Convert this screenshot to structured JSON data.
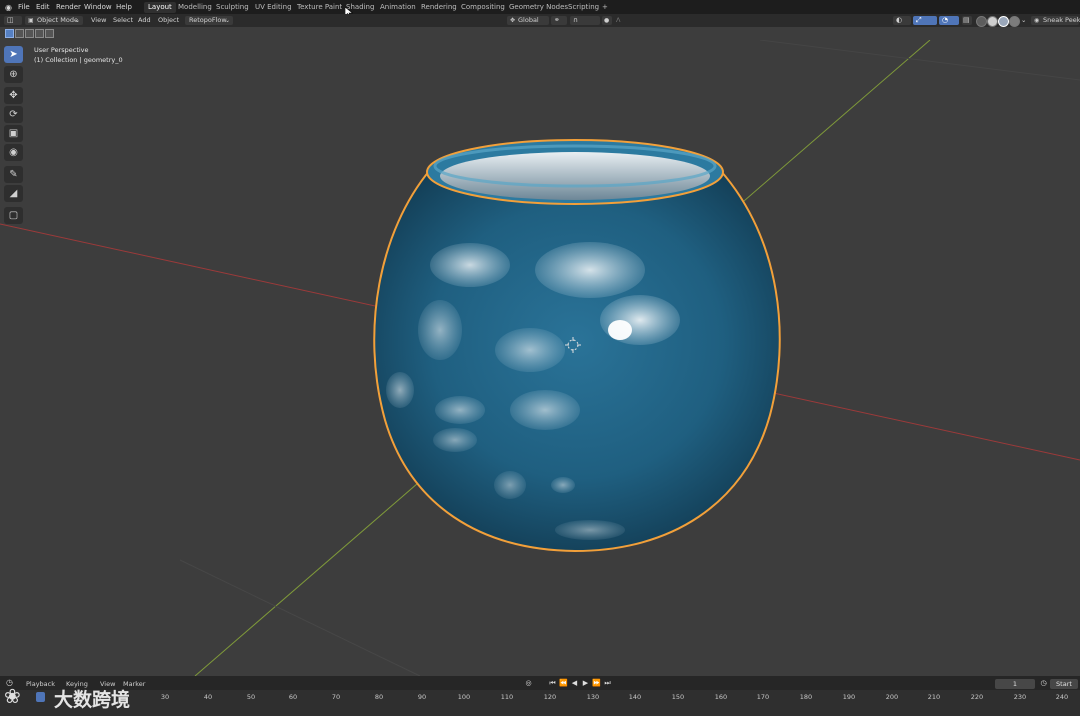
{
  "top_menu": [
    "File",
    "Edit",
    "Render",
    "Window",
    "Help"
  ],
  "workspace_tabs": [
    {
      "label": "Layout",
      "active": true
    },
    {
      "label": "Modelling",
      "active": false
    },
    {
      "label": "Sculpting",
      "active": false
    },
    {
      "label": "UV Editing",
      "active": false
    },
    {
      "label": "Texture Paint",
      "active": false
    },
    {
      "label": "Shading",
      "active": false
    },
    {
      "label": "Animation",
      "active": false
    },
    {
      "label": "Rendering",
      "active": false
    },
    {
      "label": "Compositing",
      "active": false
    },
    {
      "label": "Geometry Nodes",
      "active": false
    },
    {
      "label": "Scripting",
      "active": false
    }
  ],
  "add_workspace": "+",
  "header": {
    "mode": "Object Mode",
    "menus": [
      "View",
      "Select",
      "Add",
      "Object"
    ],
    "addon_menu": "RetopoFlow",
    "transform_orientation": "Global",
    "sneak_peek": "Sneak Peek"
  },
  "viewport": {
    "view_name": "User Perspective",
    "collection": "(1) Collection | geometry_0"
  },
  "tools": [
    "select-box",
    "cursor",
    "move",
    "rotate",
    "scale",
    "transform",
    "annotate",
    "measure",
    "add-cube"
  ],
  "timeline": {
    "menus": [
      "Playback",
      "Keying",
      "View",
      "Marker"
    ],
    "current_frame": "1",
    "start_label": "Start",
    "ruler_ticks": [
      "30",
      "40",
      "50",
      "60",
      "70",
      "80",
      "90",
      "100",
      "110",
      "120",
      "130",
      "140",
      "150",
      "160",
      "170",
      "180",
      "190",
      "200",
      "210",
      "220",
      "230",
      "240"
    ]
  },
  "watermark": "大数跨境",
  "colors": {
    "accent_blue": "#4f75b8",
    "selection_orange": "#f2a03a",
    "object_blue": "#1f5f80",
    "x_axis": "#9c3a3a",
    "y_axis": "#7f9a3a"
  }
}
